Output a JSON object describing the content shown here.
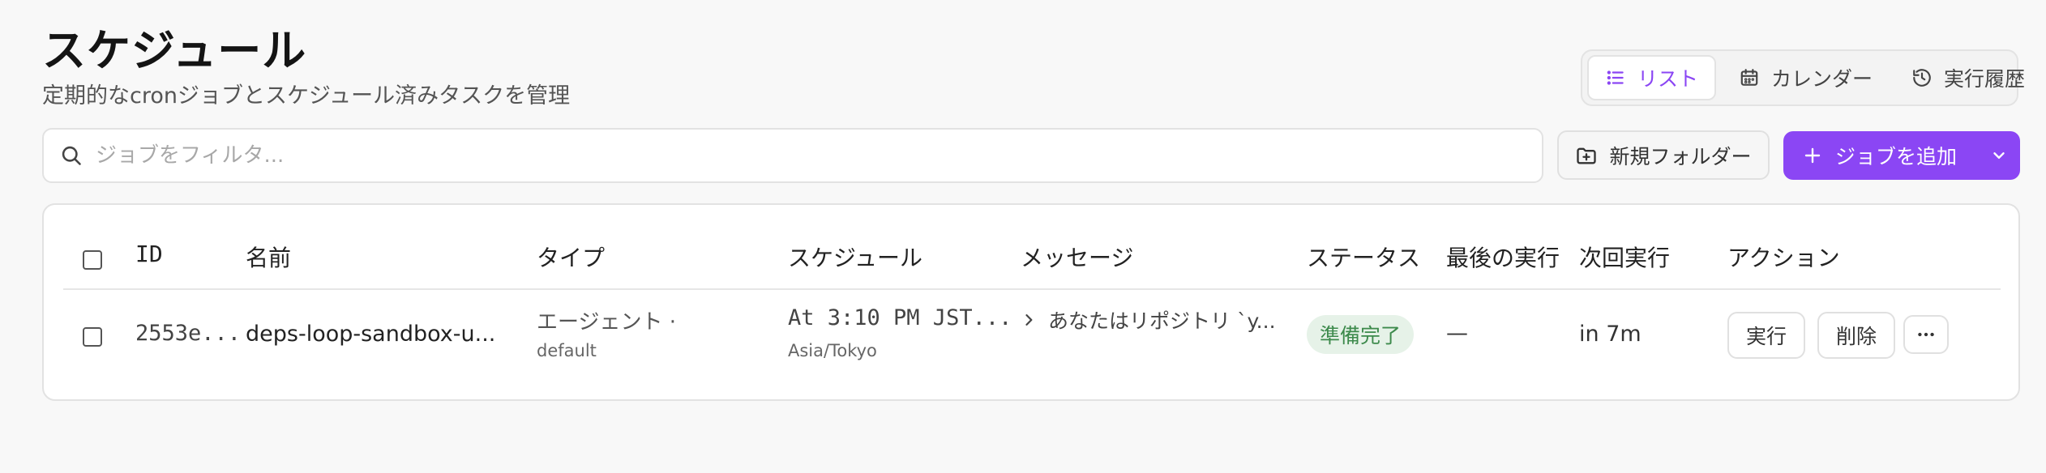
{
  "header": {
    "title": "スケジュール",
    "subtitle": "定期的なcronジョブとスケジュール済みタスクを管理"
  },
  "view_toggle": {
    "list": "リスト",
    "calendar": "カレンダー",
    "history": "実行履歴",
    "active": "list"
  },
  "search": {
    "placeholder": "ジョブをフィルタ..."
  },
  "toolbar": {
    "new_folder": "新規フォルダー",
    "add_job": "ジョブを追加"
  },
  "colors": {
    "accent": "#8b46f4",
    "status_ready_bg": "#e6f2e8",
    "status_ready_text": "#3d8a4c"
  },
  "table": {
    "columns": {
      "id": "ID",
      "name": "名前",
      "type": "タイプ",
      "schedule": "スケジュール",
      "message": "メッセージ",
      "status": "ステータス",
      "last_run": "最後の実行",
      "next_run": "次回実行",
      "actions": "アクション"
    },
    "rows": [
      {
        "id": "2553e...",
        "name": "deps-loop-sandbox-u...",
        "type": "エージェント ·",
        "type_sub": "default",
        "schedule": "At 3:10 PM JST...",
        "schedule_sub": "Asia/Tokyo",
        "message": "あなたはリポジトリ `y...",
        "status": "準備完了",
        "last_run": "—",
        "next_run": "in 7m",
        "actions": {
          "run": "実行",
          "delete": "削除"
        }
      }
    ]
  }
}
